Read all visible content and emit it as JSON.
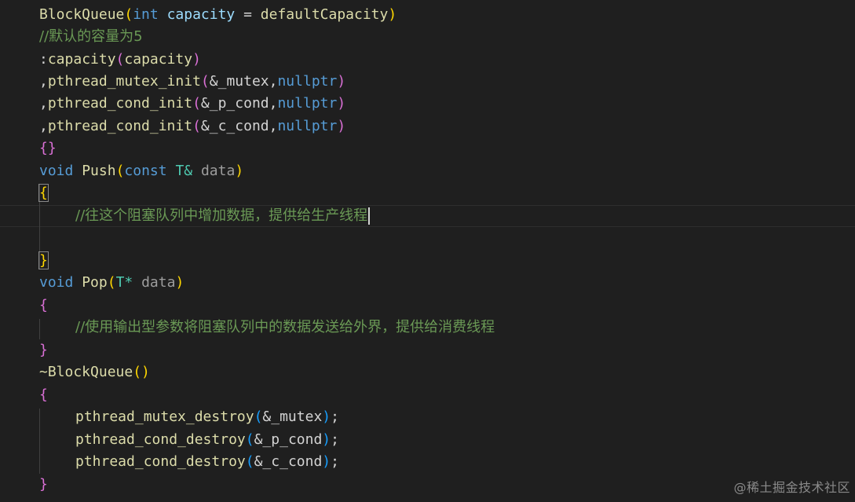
{
  "code": {
    "l1": {
      "name": "BlockQueue",
      "p_open": "(",
      "kw": "int",
      "param": "capacity",
      "eq": " = ",
      "def": "defaultCapacity",
      "p_close": ")"
    },
    "l2": {
      "comment": "//默认的容量为5"
    },
    "l3": {
      "prefix": ":",
      "name": "capacity",
      "p_open": "(",
      "arg": "capacity",
      "p_close": ")"
    },
    "l4": {
      "prefix": ",",
      "name": "pthread_mutex_init",
      "p_open": "(",
      "arg": "&_mutex,",
      "kw": "nullptr",
      "p_close": ")"
    },
    "l5": {
      "prefix": ",",
      "name": "pthread_cond_init",
      "p_open": "(",
      "arg": "&_p_cond,",
      "kw": "nullptr",
      "p_close": ")"
    },
    "l6": {
      "prefix": ",",
      "name": "pthread_cond_init",
      "p_open": "(",
      "arg": "&_c_cond,",
      "kw": "nullptr",
      "p_close": ")"
    },
    "l7": {
      "braces": "{}"
    },
    "l8": {
      "kw": "void",
      "name": "Push",
      "p_open": "(",
      "kw2": "const",
      "type": "T&",
      "param": "data",
      "p_close": ")"
    },
    "l9": {
      "brace": "{"
    },
    "l10": {
      "comment": "//往这个阻塞队列中增加数据，提供给生产线程"
    },
    "l12": {
      "brace": "}"
    },
    "l13": {
      "kw": "void",
      "name": "Pop",
      "p_open": "(",
      "type": "T*",
      "param": "data",
      "p_close": ")"
    },
    "l14": {
      "brace": "{"
    },
    "l15": {
      "comment": "//使用输出型参数将阻塞队列中的数据发送给外界，提供给消费线程"
    },
    "l16": {
      "brace": "}"
    },
    "l17": {
      "name": "~BlockQueue",
      "parens": "()"
    },
    "l18": {
      "brace": "{"
    },
    "l19": {
      "name": "pthread_mutex_destroy",
      "p_open": "(",
      "arg": "&_mutex",
      "p_close": ")",
      "semi": ";"
    },
    "l20": {
      "name": "pthread_cond_destroy",
      "p_open": "(",
      "arg": "&_p_cond",
      "p_close": ")",
      "semi": ";"
    },
    "l21": {
      "name": "pthread_cond_destroy",
      "p_open": "(",
      "arg": "&_c_cond",
      "p_close": ")",
      "semi": ";"
    },
    "l22": {
      "brace": "}"
    }
  },
  "watermark": "@稀土掘金技术社区"
}
